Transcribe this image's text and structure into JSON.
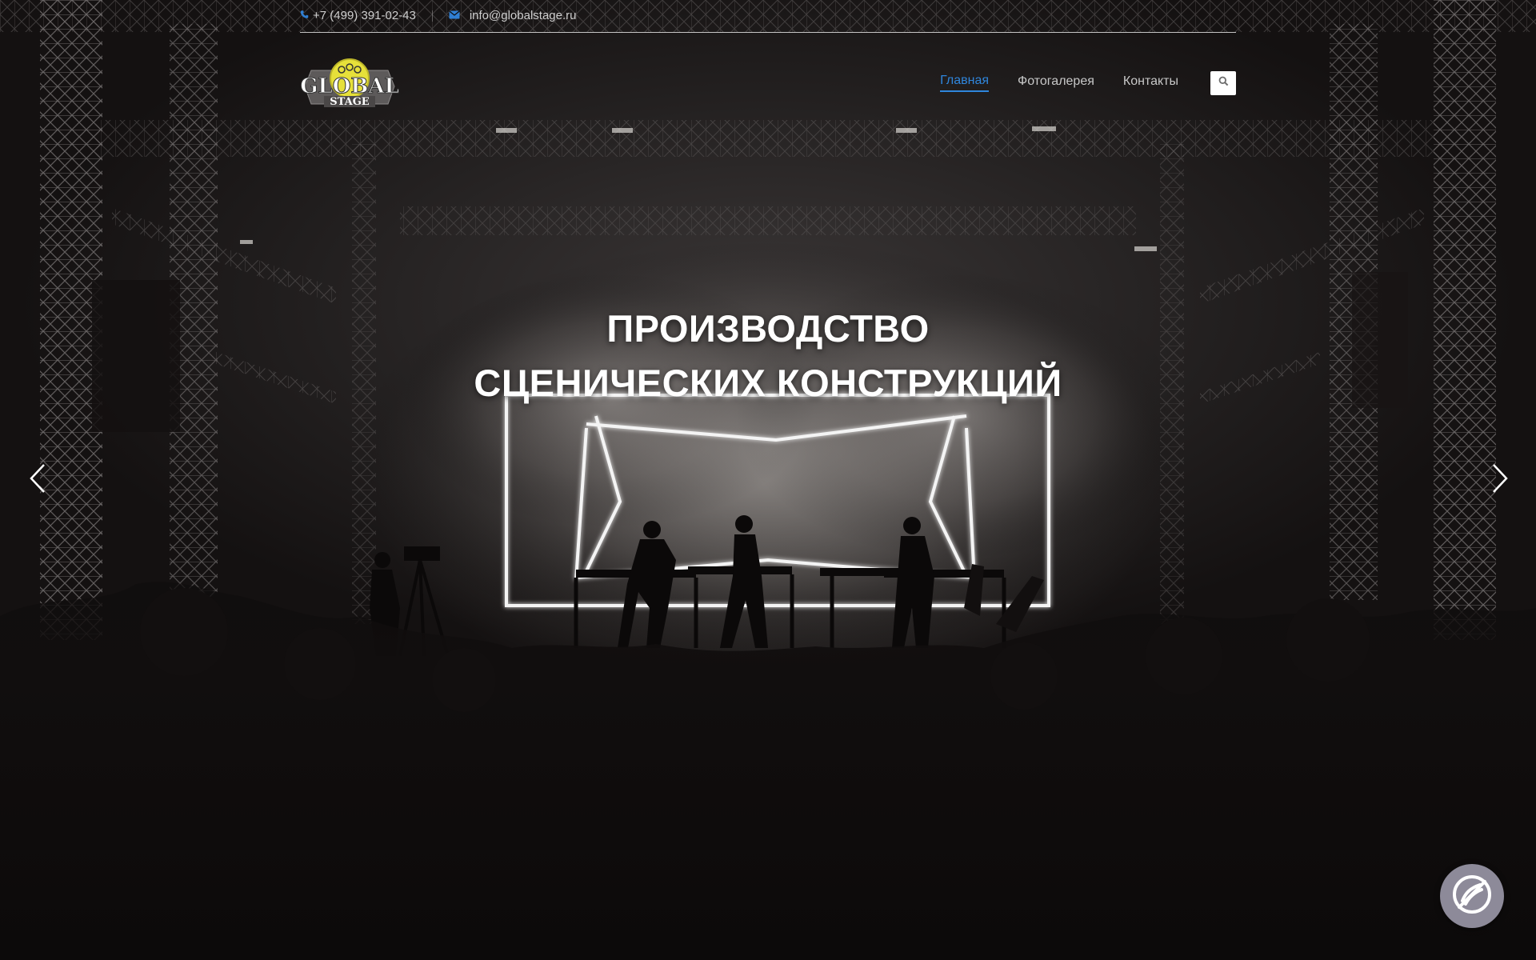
{
  "topbar": {
    "phone": "+7 (499) 391-02-43",
    "email": "info@globalstage.ru",
    "phone_icon": "phone-icon",
    "email_icon": "envelope-icon"
  },
  "logo": {
    "line1": "GLOBAL",
    "line2": "STAGE",
    "colors": {
      "circle": "#e6e03a",
      "text": "#ffffff"
    }
  },
  "nav": {
    "items": [
      {
        "label": "Главная",
        "active": true
      },
      {
        "label": "Фотогалерея",
        "active": false
      },
      {
        "label": "Контакты",
        "active": false
      }
    ],
    "search_icon": "search-icon"
  },
  "hero": {
    "title_line1": "ПРОИЗВОДСТВО",
    "title_line2": "СЦЕНИЧЕСКИХ КОНСТРУКЦИЙ",
    "prev_icon": "chevron-left-icon",
    "next_icon": "chevron-right-icon"
  },
  "widgets": {
    "accessibility_icon": "accessibility-icon"
  },
  "colors": {
    "accent": "#2f86dc",
    "nav_text": "#c8c8c8",
    "title": "#ffffff",
    "widget_bg": "#8d8a99"
  }
}
